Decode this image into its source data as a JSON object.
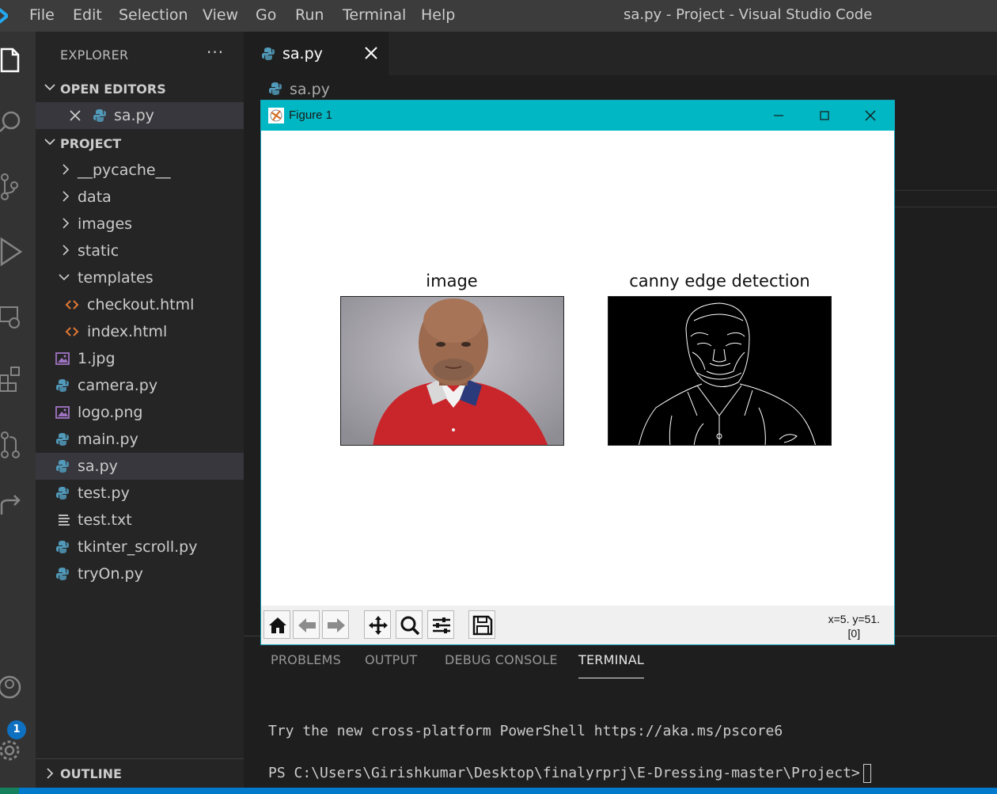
{
  "titlebar": {
    "menu": [
      "File",
      "Edit",
      "Selection",
      "View",
      "Go",
      "Run",
      "Terminal",
      "Help"
    ],
    "window_title": "sa.py - Project - Visual Studio Code"
  },
  "activity_bar": {
    "icons": [
      "explorer-icon",
      "search-icon",
      "source-control-icon",
      "run-debug-icon",
      "remote-explorer-icon",
      "extensions-icon",
      "pull-requests-icon",
      "live-share-icon",
      "accounts-icon",
      "settings-gear-icon"
    ],
    "accounts_badge": "1"
  },
  "explorer": {
    "title": "EXPLORER",
    "more": "···",
    "open_editors_label": "OPEN EDITORS",
    "open_editor_file": "sa.py",
    "project_label": "PROJECT",
    "items": [
      {
        "label": "__pycache__",
        "kind": "folder"
      },
      {
        "label": "data",
        "kind": "folder"
      },
      {
        "label": "images",
        "kind": "folder"
      },
      {
        "label": "static",
        "kind": "folder"
      },
      {
        "label": "templates",
        "kind": "folder-open"
      },
      {
        "label": "checkout.html",
        "kind": "html"
      },
      {
        "label": "index.html",
        "kind": "html"
      },
      {
        "label": "1.jpg",
        "kind": "image"
      },
      {
        "label": "camera.py",
        "kind": "python"
      },
      {
        "label": "logo.png",
        "kind": "image"
      },
      {
        "label": "main.py",
        "kind": "python"
      },
      {
        "label": "sa.py",
        "kind": "python",
        "selected": true
      },
      {
        "label": "test.py",
        "kind": "python"
      },
      {
        "label": "test.txt",
        "kind": "text"
      },
      {
        "label": "tkinter_scroll.py",
        "kind": "python"
      },
      {
        "label": "tryOn.py",
        "kind": "python"
      }
    ],
    "outline_label": "OUTLINE"
  },
  "editor": {
    "tab_label": "sa.py",
    "breadcrumb": "sa.py"
  },
  "panel": {
    "tabs": [
      "PROBLEMS",
      "OUTPUT",
      "DEBUG CONSOLE",
      "TERMINAL"
    ],
    "active_tab": "TERMINAL",
    "terminal_line1": "Try the new cross-platform PowerShell https://aka.ms/pscore6",
    "terminal_prompt": "PS C:\\Users\\Girishkumar\\Desktop\\finalyrprj\\E-Dressing-master\\Project>"
  },
  "figure": {
    "window_title": "Figure 1",
    "subplot_left_title": "image",
    "subplot_right_title": "canny edge detection",
    "coords_line1": "x=5. y=51.",
    "coords_line2": "[0]",
    "toolbar_icons": [
      "home-icon",
      "back-arrow-icon",
      "forward-arrow-icon",
      "pan-move-icon",
      "zoom-icon",
      "configure-subplots-icon",
      "save-icon"
    ]
  },
  "colors": {
    "accent": "#007acc",
    "figure_titlebar": "#00b7c3",
    "python_icon": "#519aba",
    "html_icon": "#e37933",
    "image_icon": "#a074c4"
  }
}
